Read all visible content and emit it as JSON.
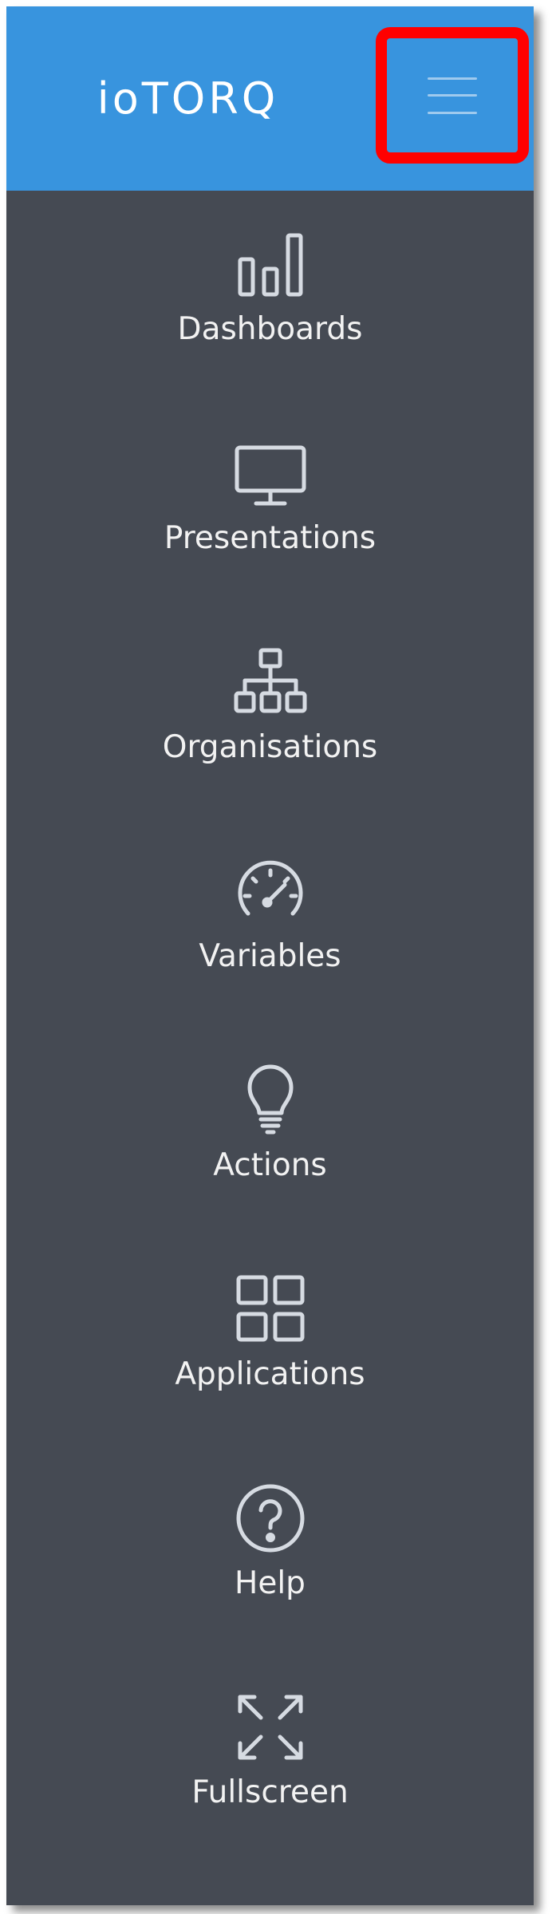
{
  "app": {
    "logo_text": "ioTORQ",
    "menu_toggle_icon": "hamburger-menu-icon"
  },
  "colors": {
    "header_bg": "#3894de",
    "sidebar_bg": "#454a53",
    "highlight_border": "#ff0000",
    "icon_stroke": "#d6dbe2",
    "label_text": "#f2f2f2"
  },
  "sidebar": {
    "items": [
      {
        "label": "Dashboards",
        "icon": "bar-chart-icon"
      },
      {
        "label": "Presentations",
        "icon": "monitor-icon"
      },
      {
        "label": "Organisations",
        "icon": "org-chart-icon"
      },
      {
        "label": "Variables",
        "icon": "speedometer-icon"
      },
      {
        "label": "Actions",
        "icon": "lightbulb-icon"
      },
      {
        "label": "Applications",
        "icon": "apps-grid-icon"
      },
      {
        "label": "Help",
        "icon": "question-circle-icon"
      },
      {
        "label": "Fullscreen",
        "icon": "expand-arrows-icon"
      }
    ]
  }
}
